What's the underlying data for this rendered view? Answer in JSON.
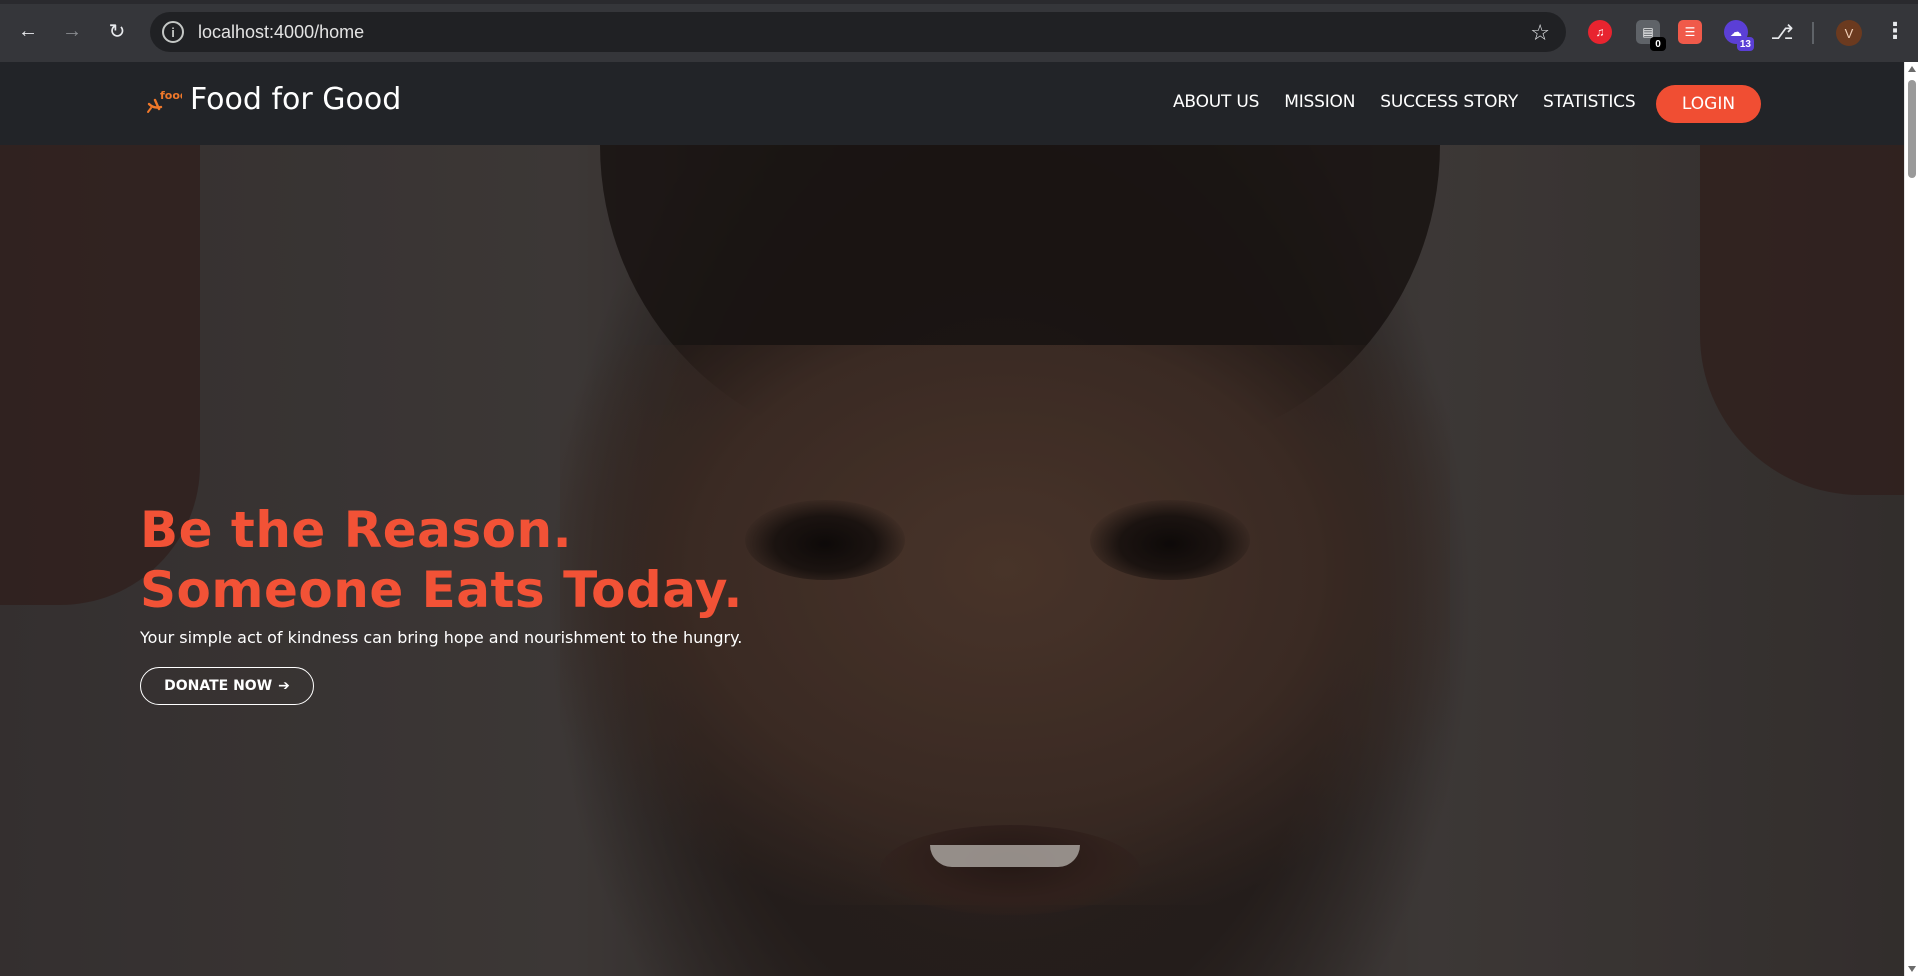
{
  "browser": {
    "url": "localhost:4000/home",
    "extensions": [
      {
        "name": "music-extension-icon",
        "color": "#e8242f",
        "badge": ""
      },
      {
        "name": "clipboard-extension-icon",
        "color": "#5f6368",
        "badge": "0"
      },
      {
        "name": "pdf-extension-icon",
        "color": "#f05a4a",
        "badge": ""
      },
      {
        "name": "cloud-extension-icon",
        "color": "#5b3fd6",
        "badge": "13"
      }
    ],
    "profile_initial": "V"
  },
  "site": {
    "brand": "Food for Good",
    "logo_text": "food",
    "nav": {
      "about": "ABOUT US",
      "mission": "MISSION",
      "success": "SUCCESS STORY",
      "statistics": "STATISTICS",
      "login": "LOGIN"
    },
    "hero": {
      "title_line1": "Be the Reason.",
      "title_line2": "Someone Eats Today.",
      "subtitle": "Your simple act of kindness can bring hope and nourishment to the hungry.",
      "cta": "DONATE NOW",
      "cta_arrow": "➔"
    },
    "accent_color": "#f04e33"
  }
}
